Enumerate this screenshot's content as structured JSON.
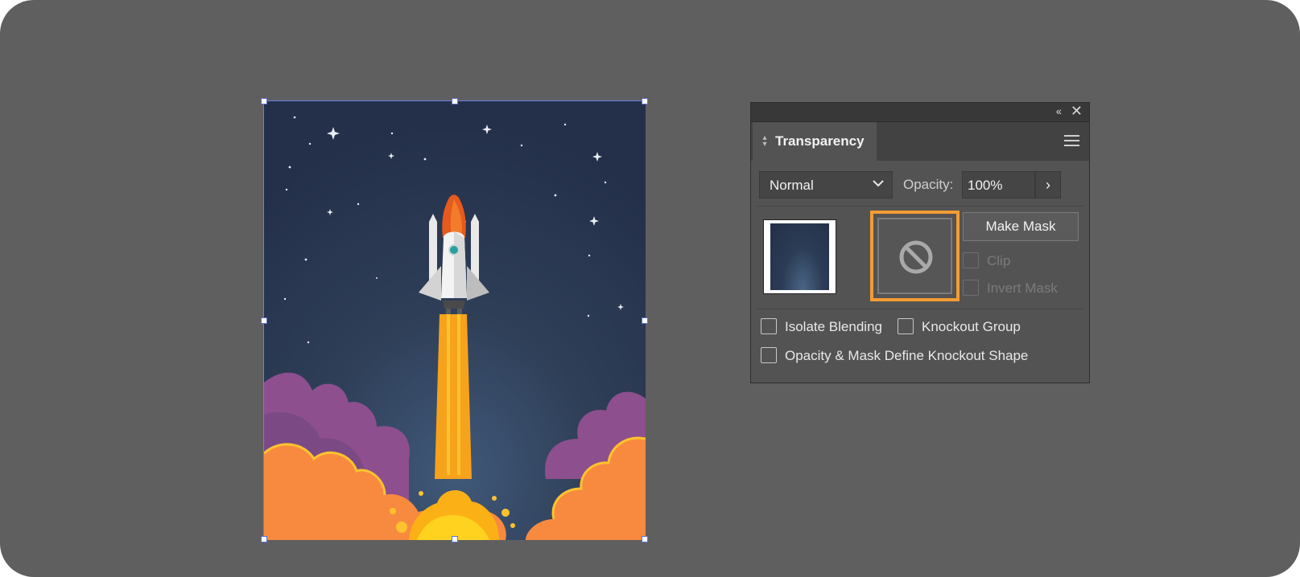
{
  "panel": {
    "title": "Transparency",
    "blend_mode": "Normal",
    "opacity_label": "Opacity:",
    "opacity_value": "100%",
    "make_mask_label": "Make Mask",
    "clip_label": "Clip",
    "invert_mask_label": "Invert Mask",
    "isolate_blending_label": "Isolate Blending",
    "knockout_group_label": "Knockout Group",
    "opacity_mask_knockout_label": "Opacity & Mask Define Knockout Shape",
    "icons": {
      "collapse": "double-chevron-left-icon",
      "close": "close-icon",
      "menu": "hamburger-menu-icon",
      "mask_placeholder": "no-symbol-icon"
    },
    "highlight_color": "#f39c34"
  },
  "artwork": {
    "subject": "rocket-launch-illustration",
    "selection_color": "#6a7fe0"
  },
  "colors": {
    "workspace": "#5f5f5f",
    "panel_bg": "#535353",
    "sky": "#2b3a52",
    "smoke_purple": "#8e4f8e",
    "smoke_orange": "#f88a3f",
    "flame": "#fdc32e"
  }
}
